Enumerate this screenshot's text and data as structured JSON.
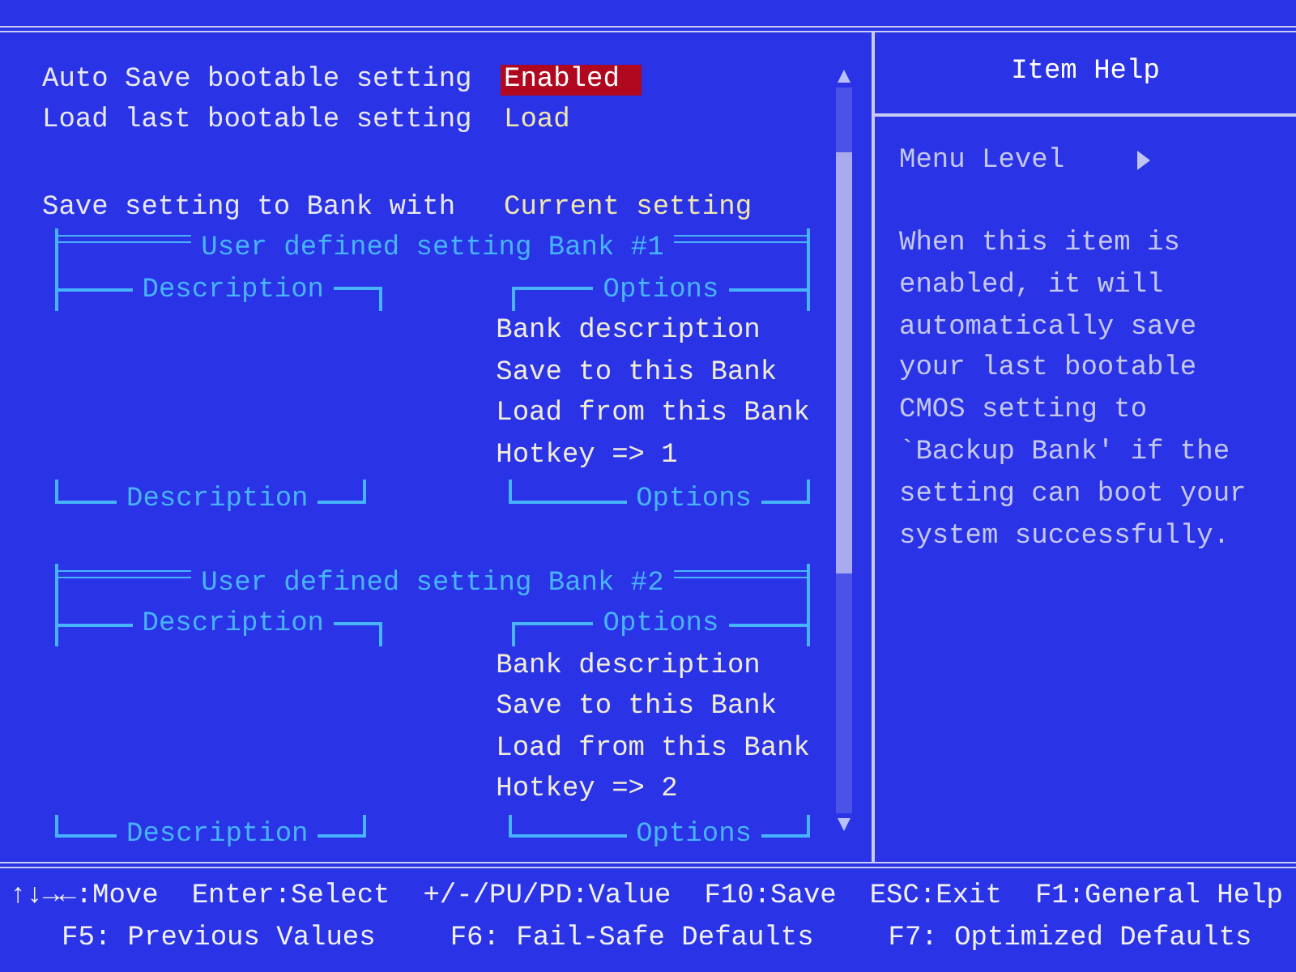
{
  "settings": [
    {
      "label": "Auto Save bootable setting",
      "value": "Enabled",
      "selected": true
    },
    {
      "label": "Load last bootable setting",
      "value": "Load",
      "selected": false
    },
    {
      "label": "Save setting to Bank with",
      "value": "Current setting",
      "selected": false
    }
  ],
  "banks": [
    {
      "title": "User defined setting Bank #1",
      "description_label": "Description",
      "options_label": "Options",
      "options": [
        "Bank description",
        "Save to this Bank",
        "Load from this Bank",
        "Hotkey => 1"
      ],
      "description_footer": "Description",
      "options_footer": "Options"
    },
    {
      "title": "User defined setting Bank #2",
      "description_label": "Description",
      "options_label": "Options",
      "options": [
        "Bank description",
        "Save to this Bank",
        "Load from this Bank",
        "Hotkey => 2"
      ],
      "description_footer": "Description",
      "options_footer": "Options"
    }
  ],
  "help": {
    "title": "Item Help",
    "menu_level": "Menu Level",
    "text": "When this item is enabled, it will automatically save your last bootable CMOS setting to `Backup Bank' if the setting can boot your system successfully."
  },
  "footer": {
    "rows": [
      {
        "items": [
          "↑↓→←:Move",
          "Enter:Select",
          "+/-/PU/PD:Value",
          "F10:Save",
          "ESC:Exit",
          "F1:General Help"
        ]
      },
      {
        "items": [
          "F5: Previous Values",
          "F6: Fail-Safe Defaults",
          "F7: Optimized Defaults"
        ]
      }
    ]
  }
}
